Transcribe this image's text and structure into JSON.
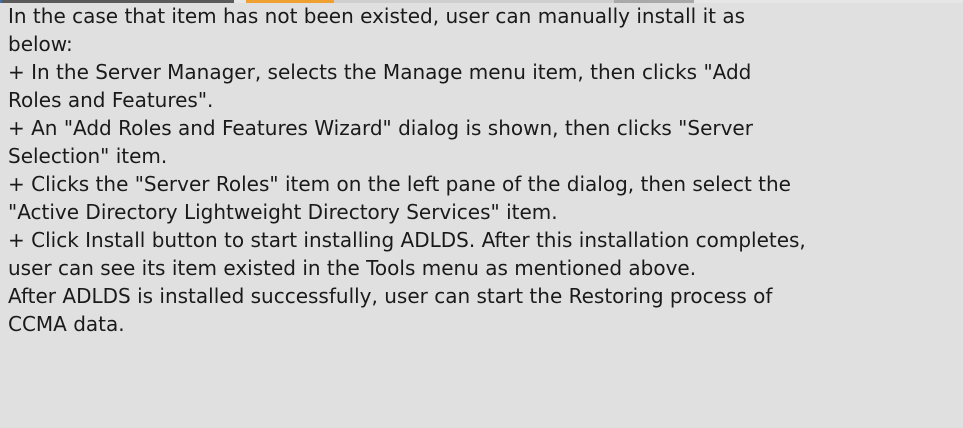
{
  "lines": [
    "In the case that item has not been existed, user can manually install it as",
    "below:",
    "+ In the Server Manager, selects the Manage menu item, then clicks \"Add",
    "Roles and Features\".",
    "+ An \"Add Roles and Features Wizard\" dialog is shown, then clicks \"Server",
    "Selection\" item.",
    "+ Clicks the \"Server Roles\" item on the left pane of the dialog, then select the",
    "\"Active Directory Lightweight Directory Services\" item.",
    "+ Click Install button to start installing ADLDS. After this installation completes,",
    "user can see its item existed in the Tools menu as mentioned above.",
    "After ADLDS is installed successfully, user can start the Restoring process of",
    "CCMA data."
  ]
}
